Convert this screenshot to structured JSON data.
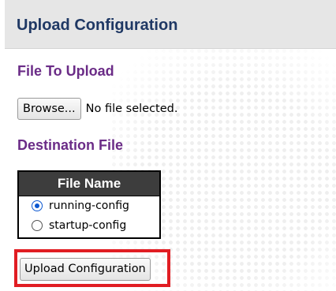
{
  "header": {
    "title": "Upload Configuration"
  },
  "file_to_upload": {
    "title": "File To Upload",
    "browse_label": "Browse...",
    "file_status": "No file selected."
  },
  "destination_file": {
    "title": "Destination File",
    "table_header": "File Name",
    "options": [
      {
        "label": "running-config",
        "selected": true
      },
      {
        "label": "startup-config",
        "selected": false
      }
    ]
  },
  "actions": {
    "upload_label": "Upload Configuration"
  },
  "colors": {
    "header_background": "#e6e6e6",
    "header_text": "#1f3864",
    "section_title": "#6b2c87",
    "table_header_background": "#3d3d3d",
    "highlight_border": "#e11d23",
    "radio_selected": "#0b57d0"
  }
}
